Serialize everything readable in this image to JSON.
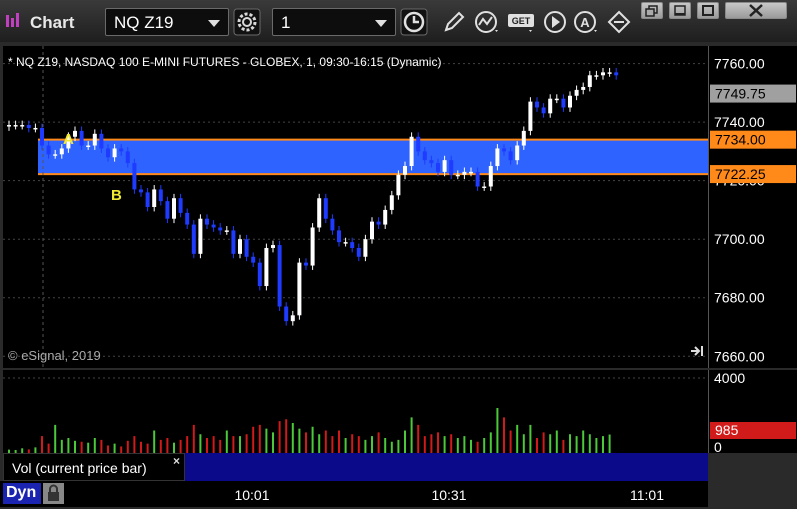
{
  "window": {
    "title": "Chart"
  },
  "toolbar": {
    "symbol": "NQ Z19",
    "interval": "1",
    "icons": [
      "settings-icon",
      "clock-icon",
      "pencil-icon",
      "study-icon",
      "get-icon",
      "play-icon",
      "annotate-icon",
      "link-icon"
    ]
  },
  "chart": {
    "header": "* NQ Z19, NASDAQ 100 E-MINI FUTURES - GLOBEX, 1, 09:30-16:15 (Dynamic)",
    "watermark": "© eSignal, 2019",
    "label_a": "A",
    "label_b": "B",
    "legend_label": "Vol (current price bar)",
    "mode_label": "Dyn",
    "colors": {
      "up": "#ffffff",
      "down": "#1f3bff",
      "band": "#2e63ff",
      "band_line": "#ff8a1a",
      "last": "#9a9a9a",
      "vol_up": "#4cc93a",
      "vol_down": "#d11a1a"
    }
  },
  "chart_data": {
    "type": "candlestick",
    "ylim": [
      7656,
      7766
    ],
    "y_ticks": [
      "7760.00",
      "7740.00",
      "7720.00",
      "7700.00",
      "7680.00",
      "7660.00"
    ],
    "x_ticks": [
      "10:01",
      "10:31",
      "11:01"
    ],
    "last_price": "7749.75",
    "band": {
      "upper": "7734.00",
      "lower": "7722.25"
    },
    "volume": {
      "ylim": [
        0,
        4000
      ],
      "y_ticks": [
        "4000",
        "0"
      ],
      "current": "985"
    },
    "closes": [
      7739,
      7739,
      7739,
      7738,
      7738,
      7732,
      7729,
      7729,
      7731,
      7735,
      7737,
      7732,
      7732,
      7736,
      7731,
      7728,
      7731,
      7730,
      7726,
      7717,
      7716,
      7711,
      7717,
      7713,
      7707,
      7714,
      7709,
      7705,
      7695,
      7707,
      7705,
      7704,
      7703,
      7703,
      7695,
      7700,
      7694,
      7692,
      7684,
      7697,
      7698,
      7677,
      7672,
      7674,
      7692,
      7691,
      7704,
      7714,
      7707,
      7703,
      7699,
      7699,
      7697,
      7694,
      7700,
      7706,
      7705,
      7710,
      7715,
      7722,
      7725,
      7735,
      7730,
      7727,
      7726,
      7723,
      7727,
      7722,
      7722,
      7723,
      7723,
      7718,
      7718,
      7725,
      7731,
      7730,
      7727,
      7732,
      7737,
      7747,
      7745,
      7743,
      7748,
      7748,
      7745,
      7749,
      7751,
      7752,
      7756,
      7756,
      7757,
      7757,
      7756
    ],
    "volumes": [
      180,
      160,
      250,
      190,
      300,
      900,
      500,
      1500,
      700,
      800,
      650,
      600,
      550,
      800,
      700,
      400,
      500,
      350,
      650,
      900,
      600,
      500,
      1200,
      700,
      800,
      550,
      700,
      900,
      1500,
      1000,
      800,
      900,
      700,
      1200,
      900,
      900,
      1000,
      1400,
      1500,
      1300,
      1100,
      1700,
      1800,
      1600,
      1300,
      1100,
      1400,
      1000,
      1200,
      900,
      1200,
      800,
      1000,
      900,
      700,
      900,
      1100,
      800,
      600,
      700,
      1200,
      1900,
      1500,
      900,
      1000,
      1100,
      900,
      1000,
      800,
      900,
      700,
      600,
      800,
      1100,
      2400,
      1900,
      1200,
      1500,
      1000,
      1500,
      800,
      1100,
      1000,
      1200,
      700,
      1000,
      900,
      1200,
      1000,
      800,
      900,
      985
    ]
  }
}
